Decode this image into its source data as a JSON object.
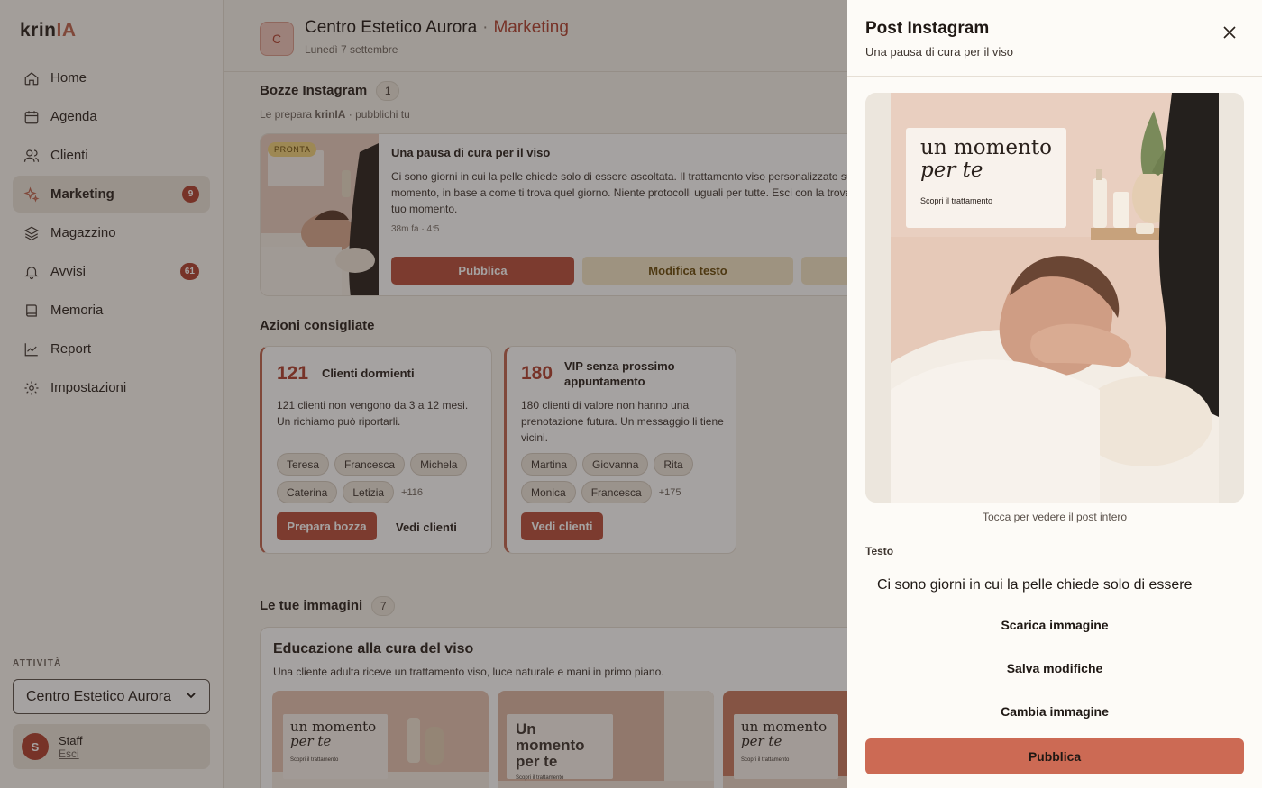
{
  "app": {
    "logo_main": "krin",
    "logo_accent": "IA"
  },
  "sidebar": {
    "items": [
      {
        "label": "Home",
        "icon": "home-icon"
      },
      {
        "label": "Agenda",
        "icon": "calendar-icon"
      },
      {
        "label": "Clienti",
        "icon": "users-icon"
      },
      {
        "label": "Marketing",
        "icon": "sparkle-icon",
        "badge": "9",
        "active": true
      },
      {
        "label": "Magazzino",
        "icon": "layers-icon"
      },
      {
        "label": "Avvisi",
        "icon": "bell-icon",
        "badge": "61"
      },
      {
        "label": "Memoria",
        "icon": "book-icon"
      },
      {
        "label": "Report",
        "icon": "chart-icon"
      },
      {
        "label": "Impostazioni",
        "icon": "gear-icon"
      }
    ],
    "section_label": "ATTIVITÀ",
    "business_select": "Centro Estetico Aurora",
    "user": {
      "initial": "S",
      "name": "Staff",
      "logout": "Esci"
    }
  },
  "header": {
    "avatar_letter": "C",
    "business": "Centro Estetico Aurora",
    "separator": "·",
    "section": "Marketing",
    "date": "Lunedì 7 settembre"
  },
  "drafts": {
    "title": "Bozze Instagram",
    "count": "1",
    "subtitle_prefix": "Le prepara ",
    "subtitle_brand": "krinIA",
    "subtitle_suffix": " · pubblichi tu",
    "card": {
      "status": "PRONTA",
      "title": "Una pausa di cura per il viso",
      "body": "Ci sono giorni in cui la pelle chiede solo di essere ascoltata. Il trattamento viso personalizzato sul momento, in base a come ti trova quel giorno. Niente protocolli uguali per tutte. Esci con la trovare il tuo momento.",
      "meta": "38m fa · 4:5",
      "publish": "Pubblica",
      "edit": "Modifica testo"
    }
  },
  "actions": {
    "title": "Azioni consigliate",
    "cards": [
      {
        "number": "121",
        "title": "Clienti dormienti",
        "desc": "121 clienti non vengono da 3 a 12 mesi. Un richiamo può riportarli.",
        "chips": [
          "Teresa",
          "Francesca",
          "Michela",
          "Caterina",
          "Letizia"
        ],
        "more": "+116",
        "primary": "Prepara bozza",
        "secondary": "Vedi clienti"
      },
      {
        "number": "180",
        "title": "VIP senza prossimo appuntamento",
        "desc": "180 clienti di valore non hanno una prenotazione futura. Un messaggio li tiene vicini.",
        "chips": [
          "Martina",
          "Giovanna",
          "Rita",
          "Monica",
          "Francesca"
        ],
        "more": "+175",
        "primary": "Vedi clienti"
      }
    ]
  },
  "images": {
    "title": "Le tue immagini",
    "count": "7",
    "card_title": "Educazione alla cura del viso",
    "card_sub": "Una cliente adulta riceve un trattamento viso, luce naturale e mani in primo piano.",
    "tiles": [
      {
        "line1": "un momento",
        "line2": "per te",
        "caption": "Scopri il trattamento"
      },
      {
        "line1": "Un momento",
        "line2": "per te",
        "caption": "Scopri il trattamento"
      },
      {
        "line1": "un momento",
        "line2": "per te",
        "caption": "Scopri il trattamento"
      }
    ]
  },
  "drawer": {
    "title": "Post Instagram",
    "subtitle": "Una pausa di cura per il viso",
    "preview": {
      "line1": "un momento",
      "line2": "per te",
      "caption": "Scopri il trattamento"
    },
    "hint": "Tocca per vedere il post intero",
    "text_label": "Testo",
    "text_preview": "Ci sono giorni in cui la pelle chiede solo di essere",
    "download": "Scarica immagine",
    "save": "Salva modifiche",
    "change": "Cambia immagine",
    "publish": "Pubblica"
  },
  "colors": {
    "accent": "#b84f3b",
    "badge": "#b0412f",
    "publish": "#cc6a54"
  }
}
